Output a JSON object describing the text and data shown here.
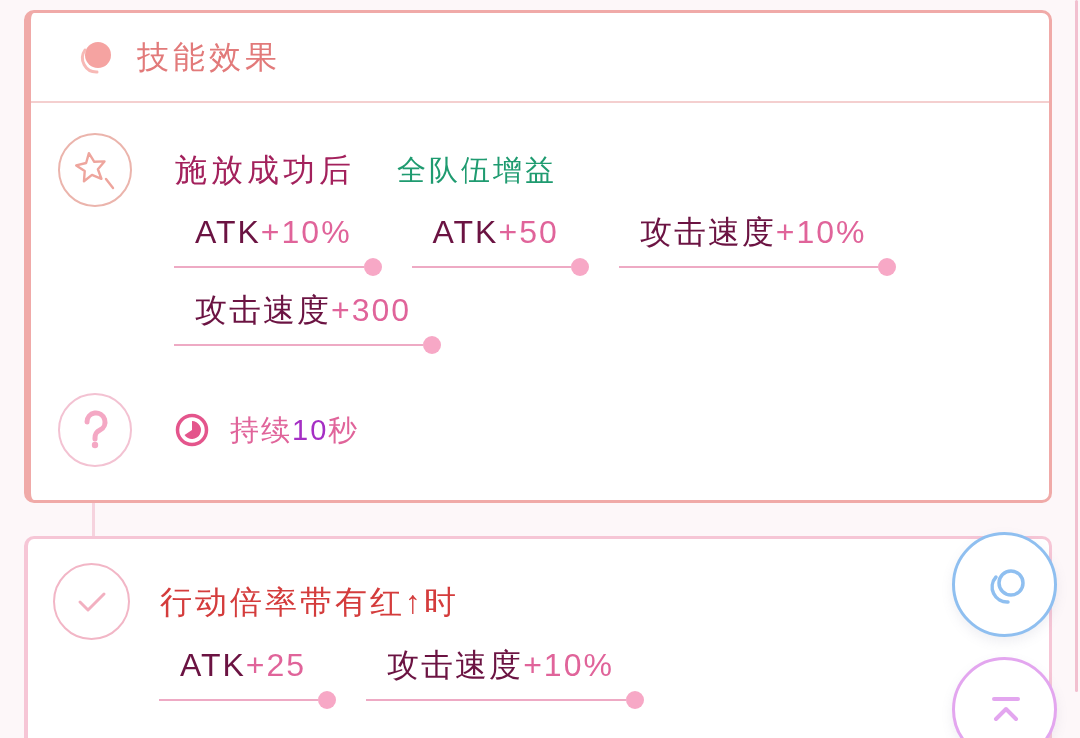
{
  "skill_effects": {
    "title": "技能效果",
    "trigger": {
      "condition": "施放成功后",
      "scope": "全队伍增益",
      "stats": [
        {
          "name": "ATK",
          "value": "+10%"
        },
        {
          "name": "ATK",
          "value": "+50"
        },
        {
          "name": "攻击速度",
          "value": "+10%"
        },
        {
          "name": "攻击速度",
          "value": "+300"
        }
      ]
    },
    "duration": {
      "prefix": "持续",
      "amount": "10",
      "suffix": "秒"
    }
  },
  "conditional_effect": {
    "condition": "行动倍率带有红↑时",
    "stats": [
      {
        "name": "ATK",
        "value": "+25"
      },
      {
        "name": "攻击速度",
        "value": "+10%"
      }
    ]
  },
  "floating_buttons": [
    {
      "kind": "rings"
    },
    {
      "kind": "back_to_top"
    }
  ]
}
